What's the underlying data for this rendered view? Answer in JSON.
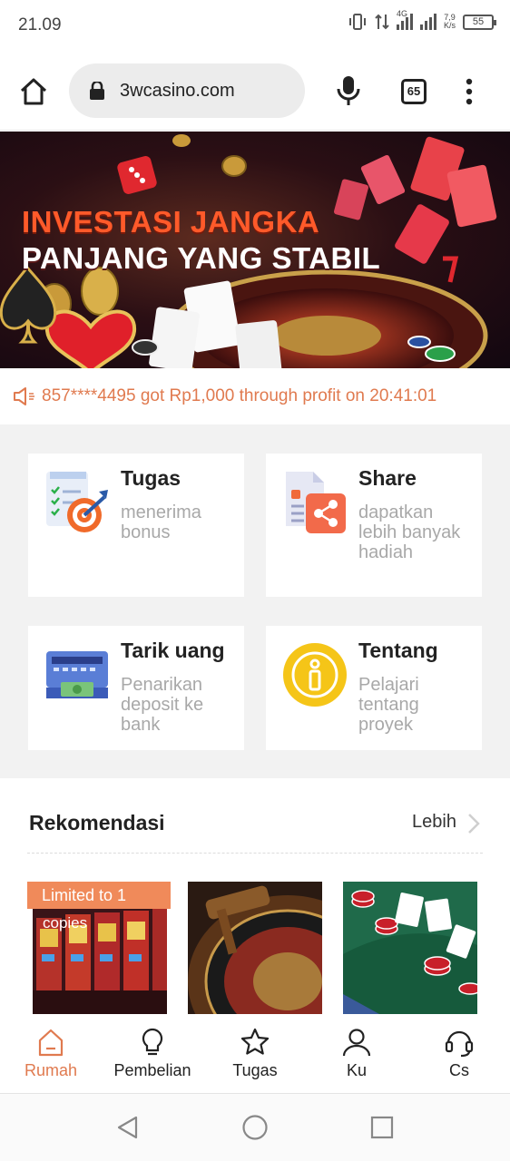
{
  "status_bar": {
    "time": "21.09",
    "network": "4G",
    "speed_value": "7,9",
    "speed_unit": "K/s",
    "battery": "55"
  },
  "browser": {
    "url": "3wcasino.com",
    "tab_count": "65",
    "icons": [
      "home-icon",
      "lock-icon",
      "mic-icon",
      "tabs-icon",
      "more-icon"
    ]
  },
  "banner": {
    "line1": "INVESTASI JANGKA",
    "line2": "PANJANG YANG STABIL"
  },
  "ticker": {
    "text": "857****4495 got Rp1,000 through profit on 20:41:01",
    "color": "#e07a4f"
  },
  "features": [
    {
      "title": "Tugas",
      "desc": "menerima bonus",
      "icon": "task-target-icon"
    },
    {
      "title": "Share",
      "desc": "dapatkan lebih banyak hadiah",
      "icon": "share-document-icon"
    },
    {
      "title": "Tarik uang",
      "desc": "Penarikan deposit ke bank",
      "icon": "atm-withdraw-icon"
    },
    {
      "title": "Tentang",
      "desc": "Pelajari tentang proyek",
      "icon": "info-icon"
    }
  ],
  "rekomendasi": {
    "title": "Rekomendasi",
    "more": "Lebih",
    "badge": "Limited to 1",
    "badge_extra": "copies",
    "items": [
      "slot-machines-image",
      "roulette-image",
      "blackjack-table-image"
    ]
  },
  "bottom_nav": {
    "active": 0,
    "active_color": "#e07a4f",
    "items": [
      {
        "label": "Rumah",
        "icon": "home-icon"
      },
      {
        "label": "Pembelian",
        "icon": "bulb-icon"
      },
      {
        "label": "Tugas",
        "icon": "star-icon"
      },
      {
        "label": "Ku",
        "icon": "user-icon"
      },
      {
        "label": "Cs",
        "icon": "headset-icon"
      }
    ]
  }
}
